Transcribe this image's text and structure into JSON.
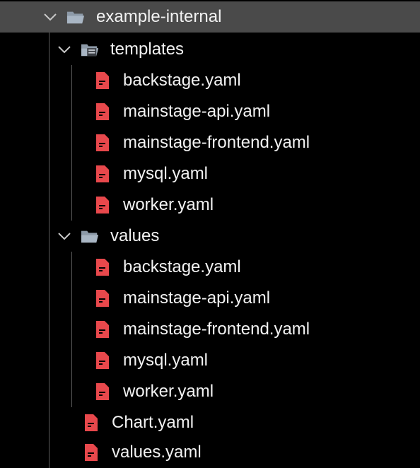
{
  "tree": {
    "root": {
      "label": "example-internal",
      "expanded": true
    },
    "templates": {
      "label": "templates",
      "expanded": true,
      "files": [
        "backstage.yaml",
        "mainstage-api.yaml",
        "mainstage-frontend.yaml",
        "mysql.yaml",
        "worker.yaml"
      ]
    },
    "values": {
      "label": "values",
      "expanded": true,
      "files": [
        "backstage.yaml",
        "mainstage-api.yaml",
        "mainstage-frontend.yaml",
        "mysql.yaml",
        "worker.yaml"
      ]
    },
    "root_files": [
      "Chart.yaml",
      "values.yaml"
    ]
  },
  "icons": {
    "folder": "folder-open-icon",
    "templates_folder": "templates-folder-icon",
    "yaml_file": "yaml-file-icon",
    "chevron": "chevron-down-icon"
  },
  "colors": {
    "background": "#000000",
    "selected_row": "#4a4a4a",
    "text": "#f2f2f2",
    "yaml_icon": "#e8484c",
    "folder_icon": "#a9b6c4"
  }
}
